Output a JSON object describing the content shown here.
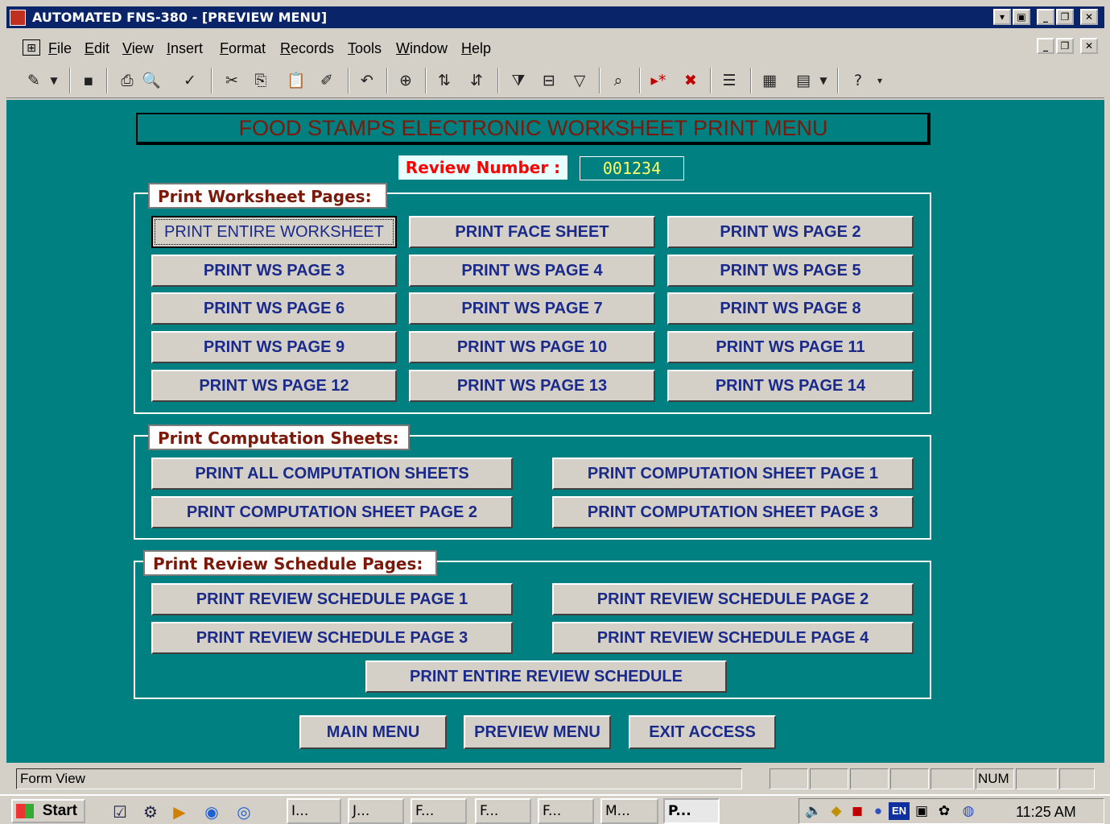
{
  "window": {
    "title": "AUTOMATED FNS-380 - [PREVIEW MENU]",
    "minimize_icon": "minimize-icon",
    "restore_icon": "restore-icon",
    "close_icon": "close-icon"
  },
  "menubar": {
    "items": [
      "File",
      "Edit",
      "View",
      "Insert",
      "Format",
      "Records",
      "Tools",
      "Window",
      "Help"
    ]
  },
  "toolbar": {
    "icons": [
      "design-view-icon",
      "save-icon",
      "print-icon",
      "print-preview-icon",
      "spelling-icon",
      "cut-icon",
      "copy-icon",
      "paste-icon",
      "format-painter-icon",
      "undo-icon",
      "hyperlink-icon",
      "sort-ascending-icon",
      "sort-descending-icon",
      "filter-by-selection-icon",
      "filter-by-form-icon",
      "apply-filter-icon",
      "find-icon",
      "new-record-icon",
      "delete-record-icon",
      "properties-icon",
      "database-window-icon",
      "new-object-icon",
      "help-icon"
    ]
  },
  "form": {
    "header_title": "FOOD STAMPS  ELECTRONIC WORKSHEET  PRINT  MENU",
    "review_number_label": "Review Number :",
    "review_number_value": "001234",
    "worksheet_group": {
      "label": "Print Worksheet Pages:",
      "buttons": [
        "PRINT ENTIRE WORKSHEET",
        "PRINT FACE SHEET",
        "PRINT WS PAGE 2",
        "PRINT WS PAGE 3",
        "PRINT WS PAGE 4",
        "PRINT WS PAGE 5",
        "PRINT WS PAGE 6",
        "PRINT WS PAGE 7",
        "PRINT WS PAGE 8",
        "PRINT WS PAGE 9",
        "PRINT WS PAGE 10",
        "PRINT WS PAGE 11",
        "PRINT WS PAGE 12",
        "PRINT WS PAGE 13",
        "PRINT WS PAGE 14"
      ]
    },
    "computation_group": {
      "label": "Print Computation Sheets:",
      "buttons": [
        "PRINT ALL COMPUTATION SHEETS",
        "PRINT COMPUTATION SHEET PAGE 1",
        "PRINT COMPUTATION SHEET PAGE 2",
        "PRINT COMPUTATION SHEET PAGE 3"
      ]
    },
    "review_schedule_group": {
      "label": "Print Review Schedule Pages:",
      "buttons": [
        "PRINT REVIEW SCHEDULE PAGE 1",
        "PRINT REVIEW SCHEDULE PAGE 2",
        "PRINT REVIEW SCHEDULE PAGE 3",
        "PRINT REVIEW SCHEDULE PAGE 4",
        "PRINT ENTIRE REVIEW SCHEDULE"
      ]
    },
    "nav_buttons": [
      "MAIN MENU",
      "PREVIEW MENU",
      "EXIT ACCESS"
    ]
  },
  "statusbar": {
    "text": "Form View",
    "num_indicator": "NUM"
  },
  "taskbar": {
    "start_label": "Start",
    "tasks": [
      "I...",
      "J...",
      "F...",
      "F...",
      "F...",
      "M...",
      "P..."
    ],
    "clock": "11:25 AM",
    "tray_lang": "EN"
  },
  "colors": {
    "form_background": "#008080",
    "title_bar": "#0a246a",
    "header_text": "#7b1a0a",
    "button_text": "#1a2a8a",
    "review_label_text": "#ff0000",
    "review_value_text": "#ffff66"
  }
}
